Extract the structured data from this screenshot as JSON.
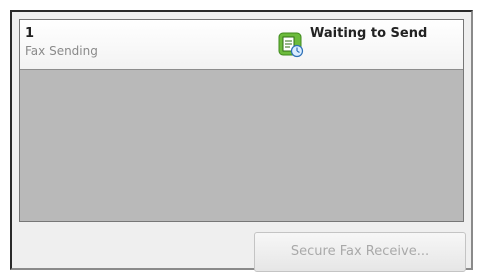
{
  "job": {
    "number": "1",
    "type": "Fax Sending",
    "status": "Waiting to Send",
    "status_icon": "fax-waiting-icon"
  },
  "actions": {
    "secure_fax_receive": "Secure Fax Receive..."
  },
  "colors": {
    "panel_bg": "#efefef",
    "list_bg": "#b9b9b9",
    "icon_green": "#6cbb3c",
    "button_disabled_text": "#a9a9a9"
  }
}
